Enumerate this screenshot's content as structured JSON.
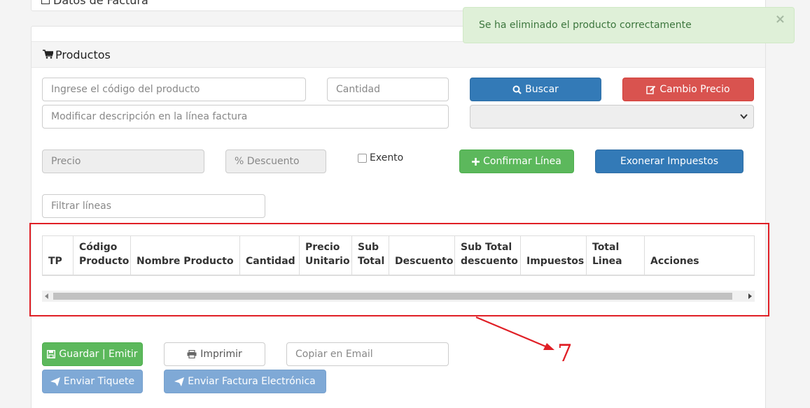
{
  "top_panel": {
    "title": "Datos de Factura"
  },
  "products_panel": {
    "heading": "Productos"
  },
  "form": {
    "codigo_placeholder": "Ingrese el código del producto",
    "cantidad_placeholder": "Cantidad",
    "descripcion_placeholder": "Modificar descripción en la línea factura",
    "precio_placeholder": "Precio",
    "descuento_placeholder": "% Descuento",
    "exento_label": "Exento",
    "filtrar_placeholder": "Filtrar líneas",
    "email_placeholder": "Copiar en Email"
  },
  "buttons": {
    "buscar": "Buscar",
    "cambio_precio": "Cambio Precio",
    "confirmar_linea": "Confirmar Línea",
    "exonerar": "Exonerar Impuestos",
    "guardar": "Guardar | Emitir",
    "imprimir": "Imprimir",
    "enviar_tiquete": "Enviar Tiquete",
    "enviar_factura": "Enviar Factura Electrónica"
  },
  "table": {
    "columns": [
      {
        "l1": "",
        "l2": "TP"
      },
      {
        "l1": "Código",
        "l2": "Producto"
      },
      {
        "l1": "",
        "l2": "Nombre Producto"
      },
      {
        "l1": "",
        "l2": "Cantidad"
      },
      {
        "l1": "Precio",
        "l2": "Unitario"
      },
      {
        "l1": "Sub",
        "l2": "Total"
      },
      {
        "l1": "",
        "l2": "Descuento"
      },
      {
        "l1": "Sub Total",
        "l2": "descuento"
      },
      {
        "l1": "",
        "l2": "Impuestos"
      },
      {
        "l1": "Total",
        "l2": "Linea"
      },
      {
        "l1": "",
        "l2": "Acciones"
      }
    ]
  },
  "toast": {
    "message": "Se ha eliminado el producto correctamente",
    "close": "×"
  },
  "annotation": {
    "number": "7",
    "color": "#e01f26"
  },
  "colors": {
    "primary": "#337ab7",
    "danger": "#d9534f",
    "success": "#5cb85c",
    "info_light": "#7fa9d6",
    "toast_bg": "#dff0d8"
  },
  "icons": {
    "heading": "shopping-cart-icon",
    "buscar": "search-icon",
    "cambio_precio": "edit-icon",
    "confirmar": "plus-icon",
    "guardar": "floppy-disk-icon",
    "imprimir": "print-icon",
    "enviar": "paper-plane-icon"
  }
}
